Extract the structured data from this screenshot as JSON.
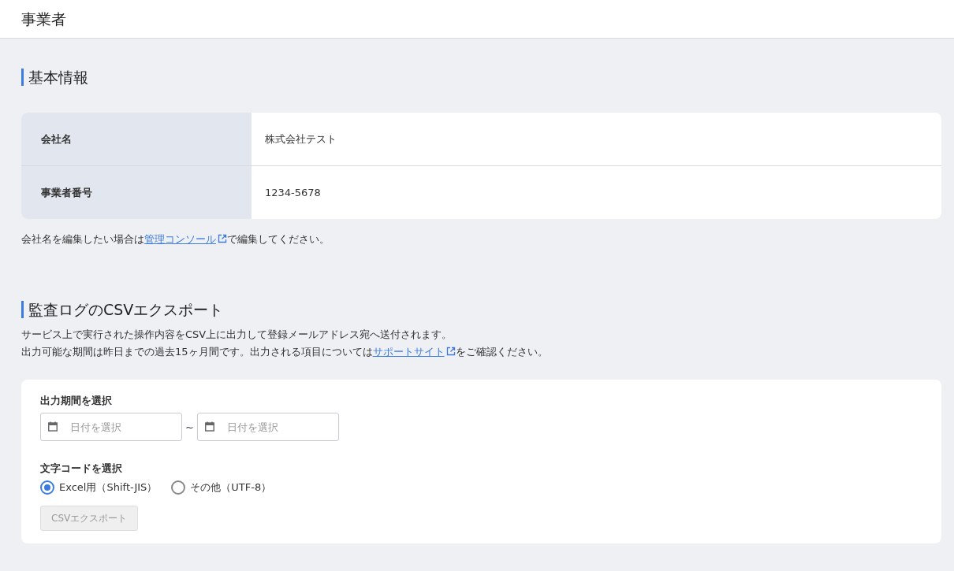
{
  "header": {
    "title": "事業者"
  },
  "basic_info": {
    "title": "基本情報",
    "rows": [
      {
        "label": "会社名",
        "value": "株式会社テスト"
      },
      {
        "label": "事業者番号",
        "value": "1234-5678"
      }
    ],
    "note": {
      "before": "会社名を編集したい場合は",
      "link": "管理コンソール",
      "after": "で編集してください。"
    }
  },
  "export": {
    "title": "監査ログのCSVエクスポート",
    "description": "サービス上で実行された操作内容をCSV上に出力して登録メールアドレス宛へ送付されます。",
    "note": {
      "before": "出力可能な期間は昨日までの過去15ヶ月間です。出力される項目については",
      "link": "サポートサイト",
      "after": "をご確認ください。"
    },
    "period": {
      "label": "出力期間を選択",
      "start_placeholder": "日付を選択",
      "separator": "~",
      "end_placeholder": "日付を選択"
    },
    "encoding": {
      "label": "文字コードを選択",
      "options": [
        {
          "label": "Excel用（Shift-JIS）",
          "selected": true
        },
        {
          "label": "その他（UTF-8）",
          "selected": false
        }
      ]
    },
    "button": {
      "label": "CSVエクスポート",
      "disabled": true
    }
  }
}
